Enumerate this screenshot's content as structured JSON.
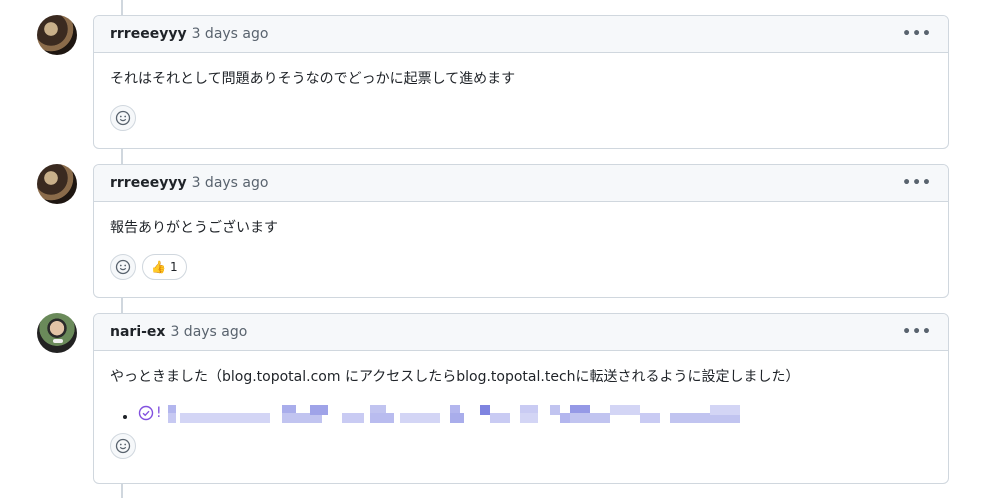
{
  "comments": [
    {
      "author": "rrreeeyyy",
      "timestamp": "3 days ago",
      "body": "それはそれとして問題ありそうなのでどっかに起票して進めます",
      "reactions": []
    },
    {
      "author": "rrreeeyyy",
      "timestamp": "3 days ago",
      "body": "報告ありがとうございます",
      "reactions": [
        {
          "emoji": "👍",
          "count": "1"
        }
      ]
    },
    {
      "author": "nari-ex",
      "timestamp": "3 days ago",
      "body": "やっときました（blog.topotal.com にアクセスしたらblog.topotal.techに転送されるように設定しました）",
      "list_item_prefix": "!"
    }
  ],
  "icons": {
    "more": "kebab-horizontal-icon",
    "add_reaction": "smiley-icon",
    "issue_status": "check-circle-icon"
  },
  "colors": {
    "link_purple": "#8250df",
    "header_bg": "#f6f8fa",
    "border": "#d0d7de"
  }
}
